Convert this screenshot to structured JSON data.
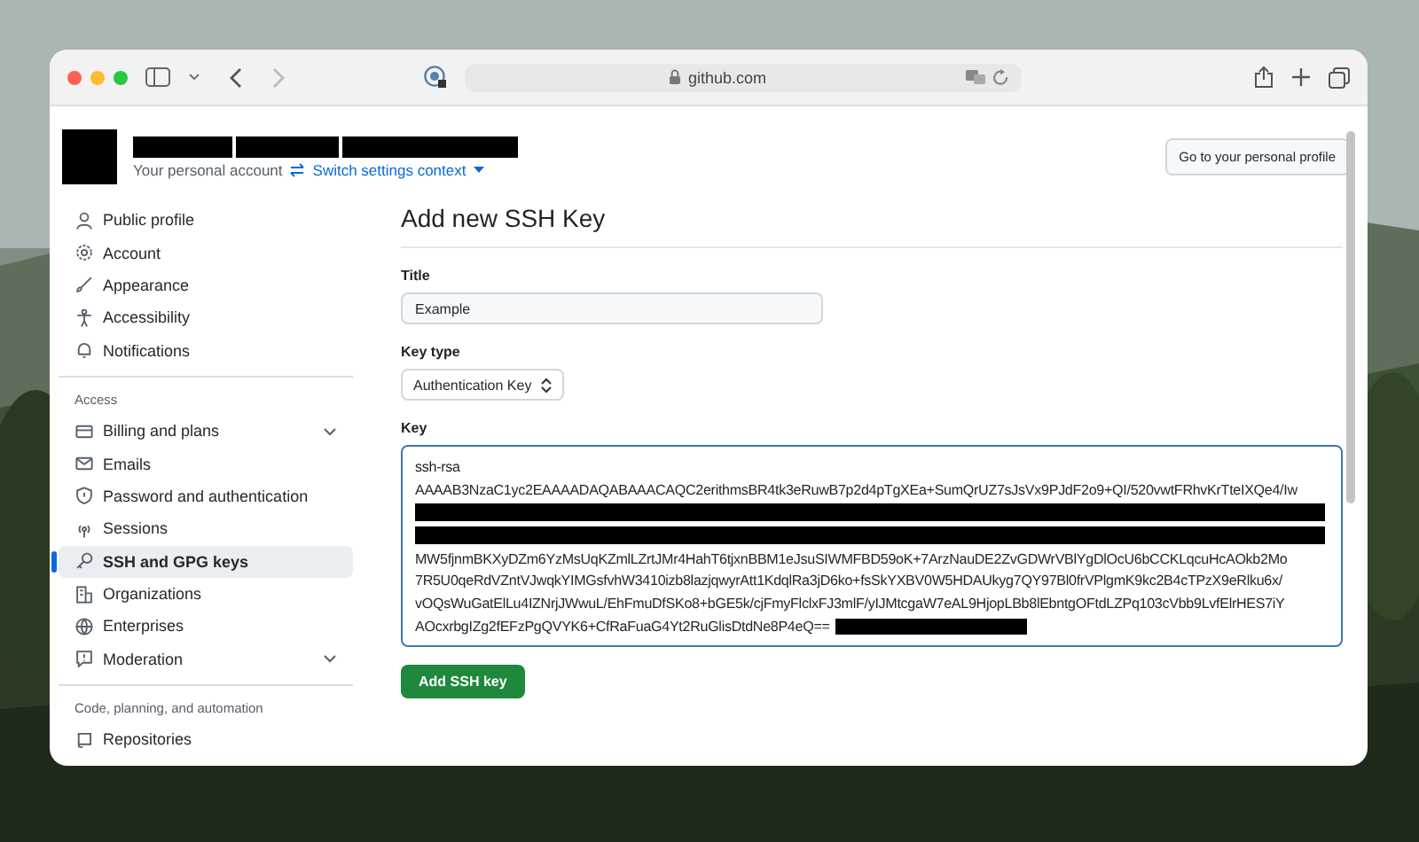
{
  "browser": {
    "url": "github.com"
  },
  "header": {
    "account_label": "Your personal account",
    "switch_link": "Switch settings context",
    "profile_button": "Go to your personal profile"
  },
  "sidebar": {
    "items": [
      {
        "kind": "item",
        "label": "Public profile",
        "selected": false
      },
      {
        "kind": "item",
        "label": "Account",
        "selected": false
      },
      {
        "kind": "item",
        "label": "Appearance",
        "selected": false
      },
      {
        "kind": "item",
        "label": "Accessibility",
        "selected": false
      },
      {
        "kind": "item",
        "label": "Notifications",
        "selected": false
      },
      {
        "kind": "heading",
        "label": "Access"
      },
      {
        "kind": "item",
        "label": "Billing and plans",
        "selected": false,
        "expandable": true
      },
      {
        "kind": "item",
        "label": "Emails",
        "selected": false
      },
      {
        "kind": "item",
        "label": "Password and authentication",
        "selected": false
      },
      {
        "kind": "item",
        "label": "Sessions",
        "selected": false
      },
      {
        "kind": "item",
        "label": "SSH and GPG keys",
        "selected": true
      },
      {
        "kind": "item",
        "label": "Organizations",
        "selected": false
      },
      {
        "kind": "item",
        "label": "Enterprises",
        "selected": false
      },
      {
        "kind": "item",
        "label": "Moderation",
        "selected": false,
        "expandable": true
      },
      {
        "kind": "heading",
        "label": "Code, planning, and automation"
      },
      {
        "kind": "item",
        "label": "Repositories",
        "selected": false
      }
    ]
  },
  "form": {
    "heading": "Add new SSH Key",
    "title_label": "Title",
    "title_value": "Example",
    "type_label": "Key type",
    "type_value": "Authentication Key",
    "key_label": "Key",
    "key_lines": [
      {
        "kind": "text",
        "text": "ssh-rsa"
      },
      {
        "kind": "text",
        "text": "AAAAB3NzaC1yc2EAAAADAQABAAACAQC2erithmsBR4tk3eRuwB7p2d4pTgXEa+SumQrUZ7sJsVx9PJdF2o9+QI/520vwtFRhvKrTteIXQe4/Iw"
      },
      {
        "kind": "redacted"
      },
      {
        "kind": "redacted"
      },
      {
        "kind": "text",
        "text": "MW5fjnmBKXyDZm6YzMsUqKZmlLZrtJMr4HahT6tjxnBBM1eJsuSIWMFBD59oK+7ArzNauDE2ZvGDWrVBlYgDlOcU6bCCKLqcuHcAOkb2Mo"
      },
      {
        "kind": "text",
        "text": "7R5U0qeRdVZntVJwqkYIMGsfvhW3410izb8lazjqwyrAtt1KdqlRa3jD6ko+fsSkYXBV0W5HDAUkyg7QY97Bl0frVPlgmK9kc2B4cTPzX9eRlku6x/"
      },
      {
        "kind": "text",
        "text": "vOQsWuGatElLu4IZNrjJWwuL/EhFmuDfSKo8+bGE5k/cjFmyFlclxFJ3mlF/yIJMtcgaW7eAL9HjopLBb8lEbntgOFtdLZPq103cVbb9LvfElrHES7iY"
      },
      {
        "kind": "text",
        "text": "AOcxrbgIZg2fEFzPgQVYK6+CfRaFuaG4Yt2RuGlisDtdNe8P4eQ==",
        "redacted_tail": true
      }
    ],
    "submit": "Add SSH key"
  }
}
